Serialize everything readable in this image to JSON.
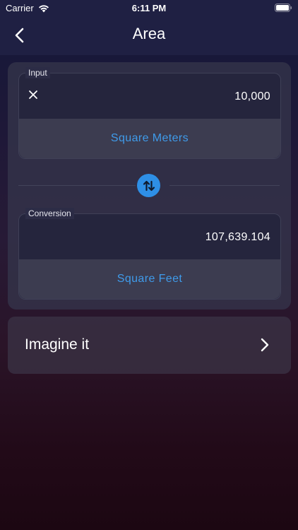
{
  "status_bar": {
    "carrier": "Carrier",
    "time": "6:11 PM"
  },
  "nav": {
    "title": "Area",
    "back_icon": "chevron-left-icon"
  },
  "converter": {
    "input": {
      "label": "Input",
      "value": "10,000",
      "unit": "Square Meters",
      "clear_icon": "close-icon"
    },
    "swap_icon": "swap-vertical-icon",
    "output": {
      "label": "Conversion",
      "value": "107,639.104",
      "unit": "Square Feet"
    }
  },
  "imagine": {
    "label": "Imagine it",
    "chevron_icon": "chevron-right-icon"
  },
  "colors": {
    "accent": "#2e8fe6",
    "unit_text": "#3f9bea",
    "header_bg": "#1f2043"
  }
}
